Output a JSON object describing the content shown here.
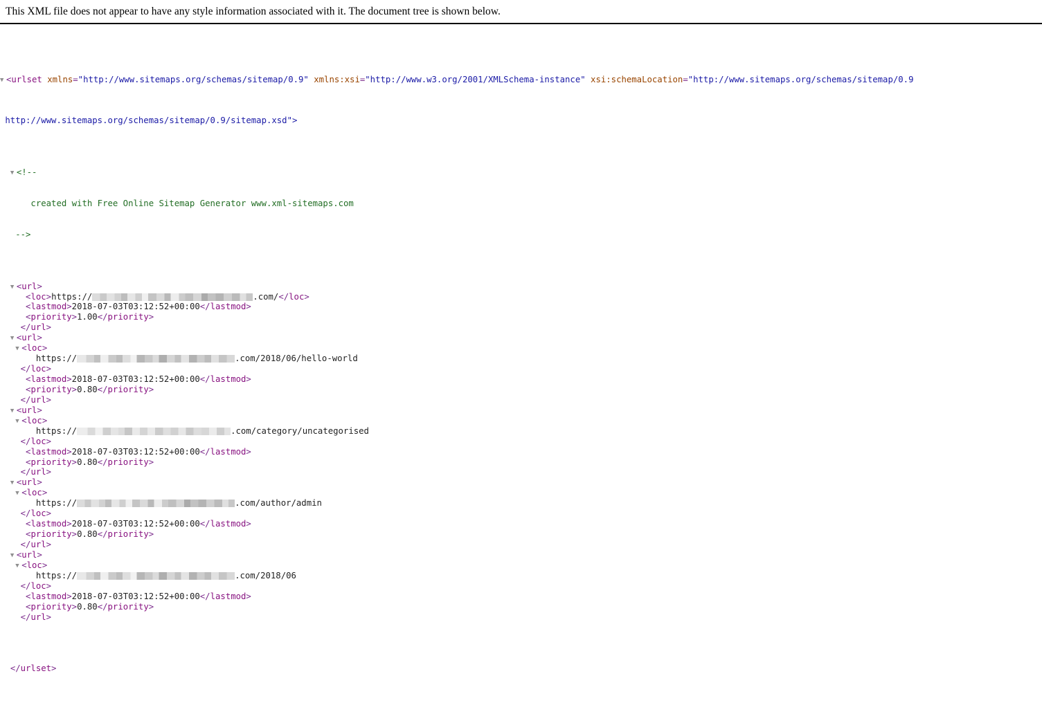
{
  "notice": {
    "text": "This XML file does not appear to have any style information associated with it. The document tree is shown below."
  },
  "colors": {
    "tag": "#881280",
    "attribute": "#994500",
    "value": "#1a1aa6",
    "comment": "#236e25",
    "text": "#222222",
    "twisty": "#8f8f8f",
    "background": "#ffffff"
  },
  "xml": {
    "root_tag": "urlset",
    "root_attributes": [
      {
        "name": "xmlns",
        "value": "\"http://www.sitemaps.org/schemas/sitemap/0.9\""
      },
      {
        "name": "xmlns:xsi",
        "value": "\"http://www.w3.org/2001/XMLSchema-instance\""
      },
      {
        "name": "xsi:schemaLocation",
        "value": "\"http://www.sitemaps.org/schemas/sitemap/0.9"
      }
    ],
    "root_attr_wrap": "http://www.sitemaps.org/schemas/sitemap/0.9/sitemap.xsd\">",
    "comment": {
      "open": "<!--",
      "body": "created with Free Online Sitemap Generator www.xml-sitemaps.com",
      "close": "-->"
    },
    "entries": [
      {
        "loc_inline": true,
        "loc_prefix": "https://",
        "loc_redacted": true,
        "loc_suffix": ".com/",
        "lastmod": "2018-07-03T03:12:52+00:00",
        "priority": "1.00"
      },
      {
        "loc_inline": false,
        "loc_prefix": "https://",
        "loc_redacted": true,
        "loc_suffix": ".com/2018/06/hello-world",
        "lastmod": "2018-07-03T03:12:52+00:00",
        "priority": "0.80"
      },
      {
        "loc_inline": false,
        "loc_prefix": "https://",
        "loc_redacted": true,
        "loc_suffix": ".com/category/uncategorised",
        "lastmod": "2018-07-03T03:12:52+00:00",
        "priority": "0.80"
      },
      {
        "loc_inline": false,
        "loc_prefix": "https://",
        "loc_redacted": true,
        "loc_suffix": ".com/author/admin",
        "lastmod": "2018-07-03T03:12:52+00:00",
        "priority": "0.80"
      },
      {
        "loc_inline": false,
        "loc_prefix": "https://",
        "loc_redacted": true,
        "loc_suffix": ".com/2018/06",
        "lastmod": "2018-07-03T03:12:52+00:00",
        "priority": "0.80"
      }
    ],
    "tags": {
      "url": "url",
      "loc": "loc",
      "lastmod": "lastmod",
      "priority": "priority"
    },
    "twisty_glyph": "▼"
  }
}
